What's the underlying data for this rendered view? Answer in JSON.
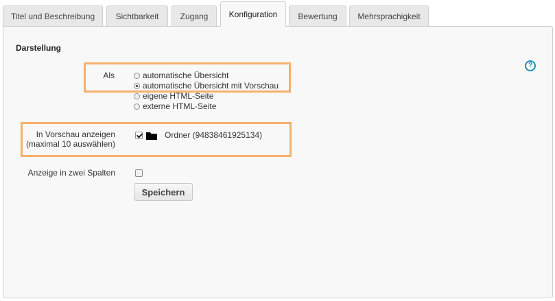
{
  "tabs": [
    {
      "label": "Titel und Beschreibung"
    },
    {
      "label": "Sichtbarkeit"
    },
    {
      "label": "Zugang"
    },
    {
      "label": "Konfiguration",
      "active": true
    },
    {
      "label": "Bewertung"
    },
    {
      "label": "Mehrsprachigkeit"
    }
  ],
  "section": {
    "title": "Darstellung"
  },
  "display_as": {
    "label": "Als",
    "options": [
      {
        "label": "automatische Übersicht",
        "selected": false
      },
      {
        "label": "automatische Übersicht mit Vorschau",
        "selected": true
      },
      {
        "label": "eigene HTML-Seite",
        "selected": false
      },
      {
        "label": "externe HTML-Seite",
        "selected": false
      }
    ]
  },
  "preview": {
    "label_line1": "In Vorschau anzeigen",
    "label_line2": "(maximal 10 auswählen)",
    "item_label": "Ordner (94838461925134)",
    "checked": true
  },
  "two_columns": {
    "label": "Anzeige in zwei Spalten",
    "checked": false
  },
  "save_label": "Speichern",
  "help_label": "?",
  "colors": {
    "highlight": "#f5b06a",
    "help": "#1f8bb5"
  }
}
